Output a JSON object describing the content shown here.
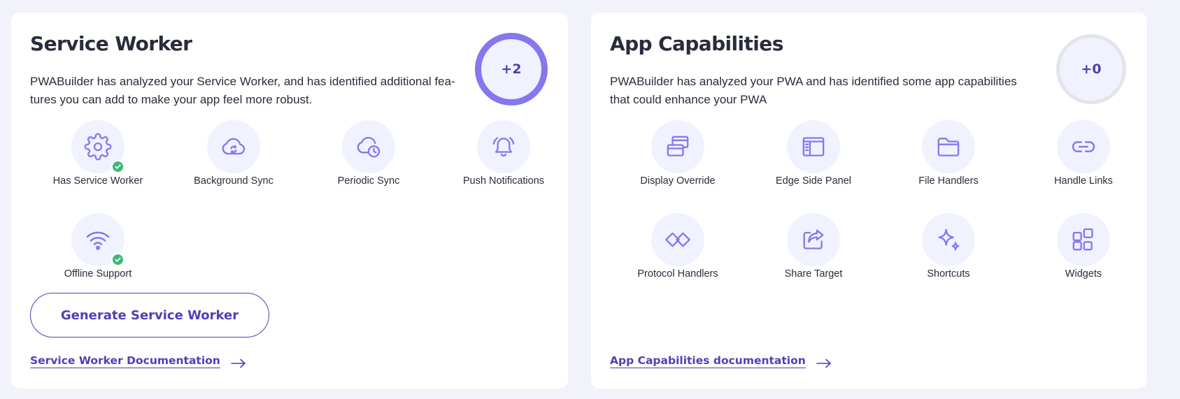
{
  "accent_color": "#4f3fb6",
  "icon_color": "#8676f0",
  "check_color": "#3cb878",
  "service_worker": {
    "title": "Service Worker",
    "description": "PWABuilder has analyzed your Service Worker, and has identified additional fea-tures you can add to make your app feel more robust.",
    "score": "+2",
    "features": [
      {
        "label": "Has Service Worker",
        "icon": "gear-icon",
        "checked": true
      },
      {
        "label": "Background Sync",
        "icon": "cloud-sync-icon",
        "checked": false
      },
      {
        "label": "Periodic Sync",
        "icon": "cloud-clock-icon",
        "checked": false
      },
      {
        "label": "Push Notifications",
        "icon": "bell-ringing-icon",
        "checked": false
      },
      {
        "label": "Offline Support",
        "icon": "wifi-icon",
        "checked": true
      }
    ],
    "generate_button": "Generate Service Worker",
    "doc_link": "Service Worker Documentation"
  },
  "app_capabilities": {
    "title": "App Capabilities",
    "description": "PWABuilder has analyzed your PWA and has identified some app capabilities that could enhance your PWA",
    "score": "+0",
    "features": [
      {
        "label": "Display Override",
        "icon": "windows-icon"
      },
      {
        "label": "Edge Side Panel",
        "icon": "side-panel-icon"
      },
      {
        "label": "File Handlers",
        "icon": "folder-icon"
      },
      {
        "label": "Handle Links",
        "icon": "link-icon"
      },
      {
        "label": "Protocol Handlers",
        "icon": "protocol-icon"
      },
      {
        "label": "Share Target",
        "icon": "share-icon"
      },
      {
        "label": "Shortcuts",
        "icon": "sparkle-icon"
      },
      {
        "label": "Widgets",
        "icon": "widgets-icon"
      }
    ],
    "doc_link": "App Capabilities documentation"
  }
}
